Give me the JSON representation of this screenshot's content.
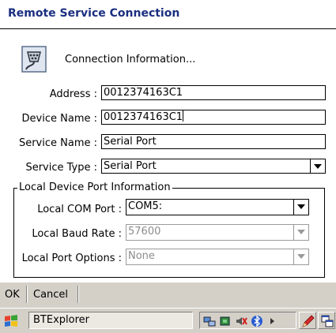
{
  "window": {
    "title": "Remote Service Connection"
  },
  "header": {
    "icon": "serial-connector-icon",
    "text": "Connection Information..."
  },
  "form": {
    "address": {
      "label": "Address :",
      "value": "0012374163C1"
    },
    "device_name": {
      "label": "Device Name :",
      "value": "0012374163C1"
    },
    "service_name": {
      "label": "Service Name :",
      "value": "Serial Port"
    },
    "service_type": {
      "label": "Service Type :",
      "value": "Serial Port"
    }
  },
  "local_port": {
    "legend": "Local Device Port Information",
    "com_port": {
      "label": "Local COM Port :",
      "value": "COM5:"
    },
    "baud_rate": {
      "label": "Local Baud Rate :",
      "value": "57600"
    },
    "port_options": {
      "label": "Local Port Options :",
      "value": "None"
    }
  },
  "menu": {
    "ok": "OK",
    "cancel": "Cancel"
  },
  "taskbar": {
    "start_icon": "windows-flag-icon",
    "task_label": "BTExplorer",
    "tray_icons": [
      "network-icon",
      "bluetooth-device-icon",
      "speaker-icon",
      "bluetooth-icon",
      "arrow-right-icon"
    ],
    "buttons": [
      "pen-icon",
      "windows-switch-icon"
    ]
  }
}
